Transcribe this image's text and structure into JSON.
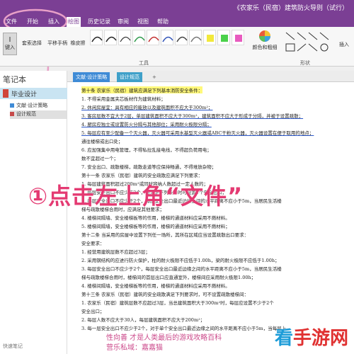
{
  "window": {
    "title": "《农家乐（民宿）建筑防火导则（试行）"
  },
  "ribbon_tabs": [
    {
      "label": "文件"
    },
    {
      "label": "开始"
    },
    {
      "label": "插入"
    },
    {
      "label": "绘图",
      "active": true
    },
    {
      "label": "历史记录"
    },
    {
      "label": "审阅"
    },
    {
      "label": "视图"
    },
    {
      "label": "帮助"
    }
  ],
  "ribbon": {
    "type_btn": "键入",
    "lasso_btn": "套索选择",
    "pan_btn": "平移手柄",
    "eraser_btn": "橡皮擦",
    "tools_group": "工具",
    "color_btn": "颜色和粗细",
    "shapes_group": "形状",
    "insert_btn": "插入"
  },
  "sidebar": {
    "title": "笔记本",
    "notebook": "毕业设计",
    "sections": [
      {
        "label": "文献·设计策略",
        "color": "#3f8bd6"
      },
      {
        "label": "设计规范",
        "color": "#c64a4a",
        "active": true
      }
    ],
    "quick_notes": "快速笔记"
  },
  "page_tabs": [
    {
      "label": "文献·设计策略",
      "color": "#3f8bd6"
    },
    {
      "label": "设计规范",
      "color": "#3fa0c9"
    },
    {
      "label": "+"
    }
  ],
  "document_lines": [
    {
      "text": "第十条 农家乐（民宿）建筑应满足下列基本消防安全条件：",
      "style": "hl"
    },
    {
      "text": "1. 不得采用金属夹芯板材作为建筑材料；",
      "style": ""
    },
    {
      "text": "2. 休闲房屋宜：具有相应的能放以及建筑面积不应大于300m²；",
      "style": "ul"
    },
    {
      "text": "3. 客房层数不宜大于2层，单层建筑面积不应大于300m²，建筑面积不应大于形成于分隔，并被于设置疏散；",
      "style": "ul"
    },
    {
      "text": "4. 厨房应独立或设置防火分隔与其他部位；采用耐火极限分隔；",
      "style": "ul"
    },
    {
      "text": "5. 每层应有至少配备一个灭火器，灭火器可采用水基型灭火器或ABC干粉灭火器，灭火器设置在便于取用的地点；",
      "style": "ul"
    },
    {
      "text": "   通往楼梯或出口处；",
      "style": ""
    },
    {
      "text": "6. 应加强集中用电管理，不得私拉乱接电线，不得超负荷用电；",
      "style": ""
    },
    {
      "text": "   数不宜超过一个；",
      "style": ""
    },
    {
      "text": "7. 安全出口、疏散楼梯，疏散走道等应保持畅通，不得堆放杂物；",
      "style": ""
    },
    {
      "text": "第十一条 农家乐（民宿）建筑的安全疏散应满足下列要求：",
      "style": ""
    },
    {
      "text": "1. 每层建筑面积超过200m²或同时容纳人数超过一定人数的；",
      "style": ""
    },
    {
      "text": "2. 每层安全出口不应少于2个，当满足下列条件时可设置1个安全出口；",
      "style": ""
    },
    {
      "text": "3. 每层安全出口不应少于2个，每层安全出口最近边缘之间的水平距离不应小于5m，当居民生活楼",
      "style": ""
    },
    {
      "text": "   梯与疏散楼梯合用时，应满足其他要求；",
      "style": ""
    },
    {
      "text": "4. 楼梯间隔墙、安全楼梯板等的作用，楼梯的通道材料应采用不燃材料。",
      "style": ""
    },
    {
      "text": "5. 楼梯间隔墙，安全楼梯板等的作用，楼梯的通道材料应采用不燃材料；",
      "style": ""
    },
    {
      "text": "第十二条 当采用的房屋中设置下列任一场所，其所在区域应当设置疏散出口要求：",
      "style": ""
    },
    {
      "text": "   安全要求：",
      "style": ""
    },
    {
      "text": "1. 经营用建筑层数不应超过3层；",
      "style": ""
    },
    {
      "text": "2. 采用钢结构的应进行防火保护，柱的耐火极限不应低于1.00h，梁的耐火极限不应低于1.00h；",
      "style": ""
    },
    {
      "text": "3. 每层安全出口不应少于2个，每层安全出口最近边缘之间的水平距离不应小于5m，当居民生活楼",
      "style": ""
    },
    {
      "text": "   梯与疏散楼梯合用时，楼梯间的首层出口应直通室外，楼梯间应采用耐火极限1.00h；",
      "style": ""
    },
    {
      "text": "4. 楼梯间隔墙，安全楼梯板等的作用，楼梯的通道材料应采用不燃材料。",
      "style": ""
    },
    {
      "text": "第十三条 农家乐（民宿）建筑的安全疏散满足下列要求时，可不设置疏散楼梯间：",
      "style": ""
    },
    {
      "text": "1. 农家乐（民宿）建筑层数不应超过3层，当总建筑面积大于300m²时，每层应设置不少于2个",
      "style": ""
    },
    {
      "text": "   安全出口；",
      "style": ""
    },
    {
      "text": "2. 每层人数不应大于30人，每层建筑面积不应大于200m²；",
      "style": ""
    },
    {
      "text": "3. 每一层安全出口不应少于2个，对于单个安全出口最近边缘之间的水平距离不应小于5m，当每层上",
      "style": ""
    }
  ],
  "annotation": "①点击左上角“文件”",
  "watermark": {
    "line1": "性向善 才是人类最后的游戏攻略百科",
    "line2": "营乐私域：嘉嘉猫"
  },
  "logo": {
    "mark": "看",
    "text": "手游网"
  }
}
